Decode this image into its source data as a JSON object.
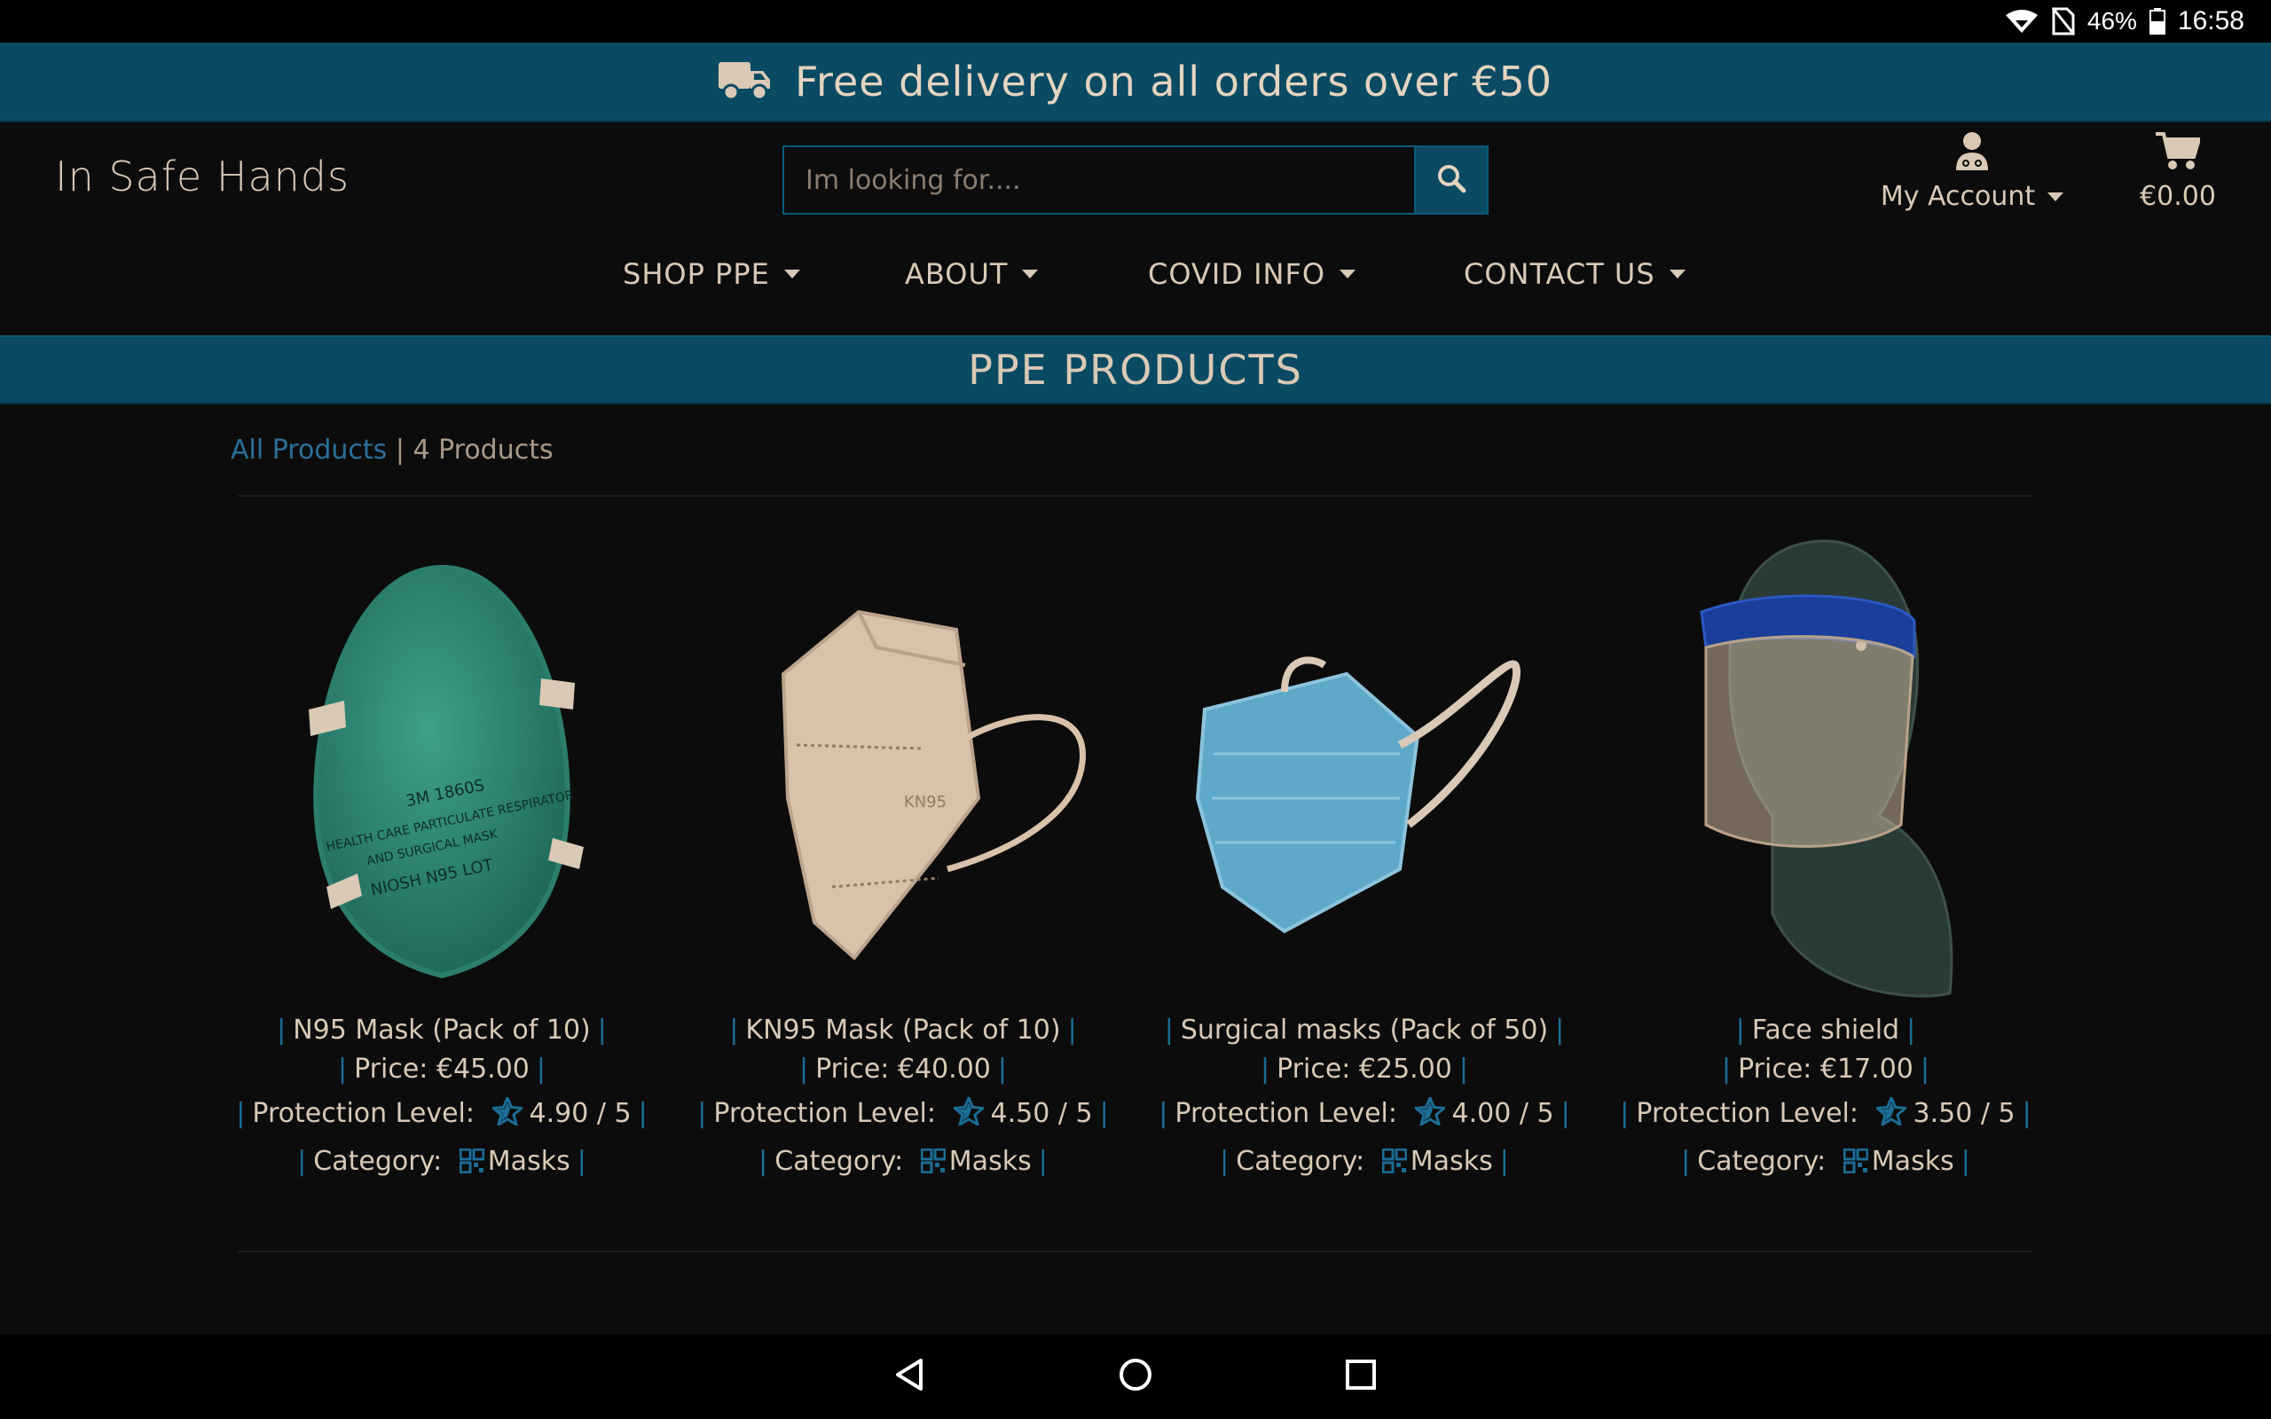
{
  "status_bar": {
    "battery": "46%",
    "time": "16:58",
    "icons": [
      "wifi-icon",
      "no-sim-icon",
      "battery-icon"
    ]
  },
  "promo": {
    "icon": "truck-icon",
    "text": "Free delivery on all orders over €50"
  },
  "header": {
    "brand": "In Safe Hands",
    "search_placeholder": "Im looking for....",
    "search_icon": "search-icon",
    "account_label": "My Account",
    "account_icon": "user-doctor-icon",
    "cart_total": "€0.00",
    "cart_icon": "cart-icon"
  },
  "nav": {
    "items": [
      {
        "label": "SHOP PPE"
      },
      {
        "label": "ABOUT"
      },
      {
        "label": "COVID INFO"
      },
      {
        "label": "CONTACT US"
      }
    ]
  },
  "section": {
    "title": "PPE PRODUCTS"
  },
  "breadcrumb": {
    "link": "All Products",
    "separator": "|",
    "count": "4 Products"
  },
  "products": [
    {
      "name": "N95 Mask (Pack of 10)",
      "price": "Price: €45.00",
      "protection_label": "Protection Level:",
      "rating": "4.90 / 5",
      "category_label": "Category:",
      "category": "Masks"
    },
    {
      "name": "KN95 Mask (Pack of 10)",
      "price": "Price: €40.00",
      "protection_label": "Protection Level:",
      "rating": "4.50 / 5",
      "category_label": "Category:",
      "category": "Masks"
    },
    {
      "name": "Surgical masks (Pack of 50)",
      "price": "Price: €25.00",
      "protection_label": "Protection Level:",
      "rating": "4.00 / 5",
      "category_label": "Category:",
      "category": "Masks"
    },
    {
      "name": "Face shield",
      "price": "Price: €17.00",
      "protection_label": "Protection Level:",
      "rating": "3.50 / 5",
      "category_label": "Category:",
      "category": "Masks"
    }
  ],
  "colors": {
    "background": "#0d0c0c",
    "accent": "#0a4a63",
    "separator": "#1b6d96",
    "text": "#d9c9b6"
  },
  "system_nav": [
    "back-icon",
    "home-icon",
    "recents-icon"
  ]
}
